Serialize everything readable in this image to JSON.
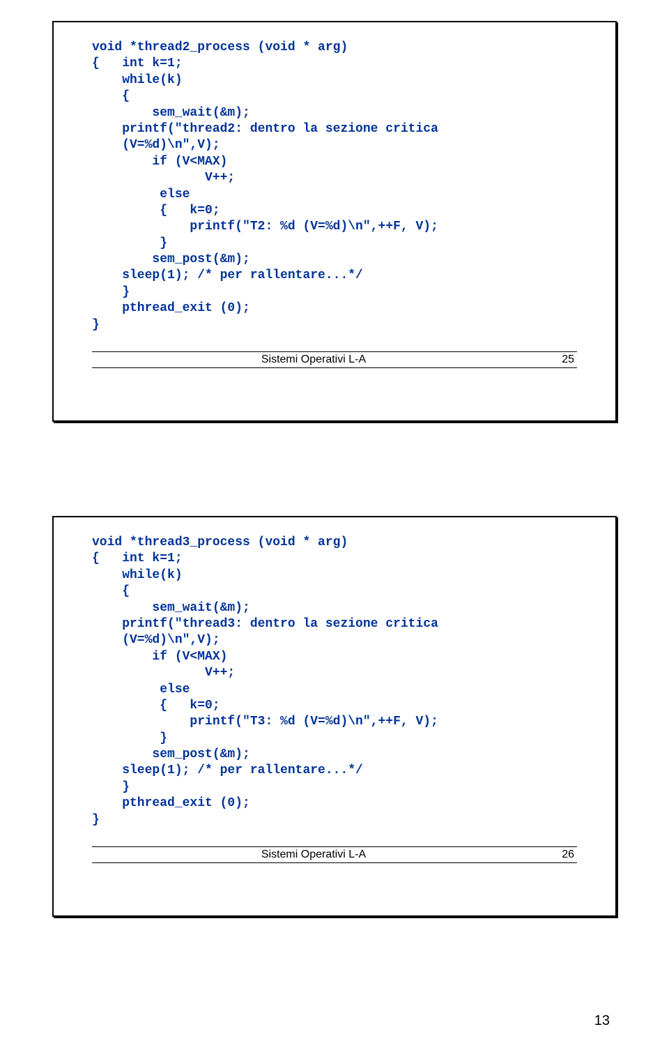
{
  "slide1": {
    "code": "void *thread2_process (void * arg)\n{   int k=1;\n    while(k)\n    {\n        sem_wait(&m);\n    printf(\"thread2: dentro la sezione critica\n    (V=%d)\\n\",V);\n        if (V<MAX)\n               V++;\n         else\n         {   k=0;\n             printf(\"T2: %d (V=%d)\\n\",++F, V);\n         }\n        sem_post(&m);\n    sleep(1); /* per rallentare...*/\n    }\n    pthread_exit (0);\n}",
    "footer_label": "Sistemi Operativi L-A",
    "footer_num": "25"
  },
  "slide2": {
    "code": "void *thread3_process (void * arg)\n{   int k=1;\n    while(k)\n    {\n        sem_wait(&m);\n    printf(\"thread3: dentro la sezione critica\n    (V=%d)\\n\",V);\n        if (V<MAX)\n               V++;\n         else\n         {   k=0;\n             printf(\"T3: %d (V=%d)\\n\",++F, V);\n         }\n        sem_post(&m);\n    sleep(1); /* per rallentare...*/\n    }\n    pthread_exit (0);\n}",
    "footer_label": "Sistemi Operativi L-A",
    "footer_num": "26"
  },
  "page_number": "13"
}
